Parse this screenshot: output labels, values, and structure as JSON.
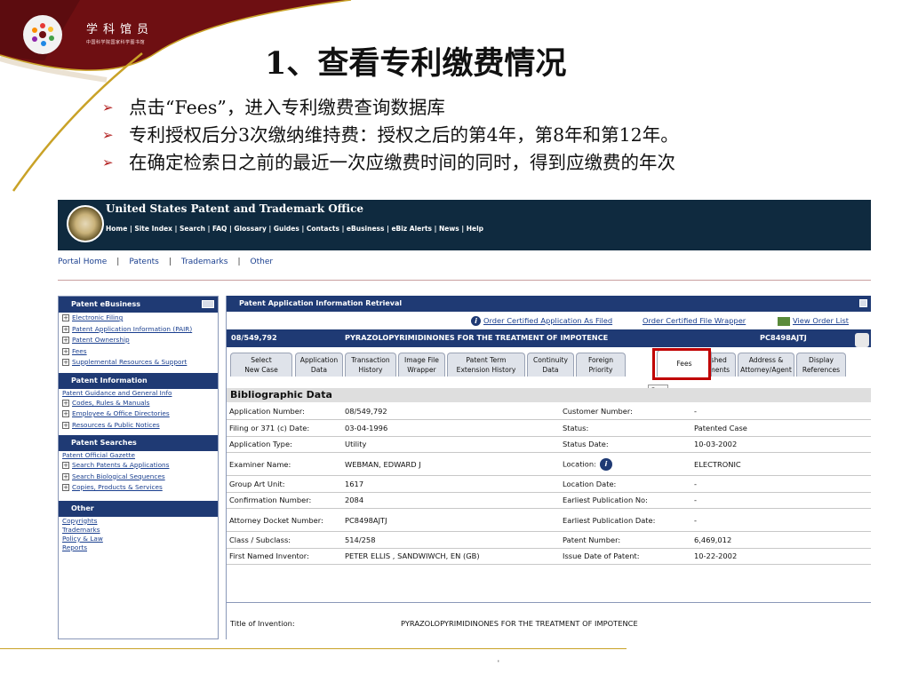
{
  "slide": {
    "logo_title": "学科馆员",
    "logo_subtitle": "中国科学院国家科学图书馆",
    "title": "1、查看专利缴费情况",
    "bullets": [
      "点击“Fees”，进入专利缴费查询数据库",
      "专利授权后分3次缴纳维持费：授权之后的第4年，第8年和第12年。",
      "在确定检索日之前的最近一次应缴费时间的同时，得到应缴费的年次"
    ],
    "page_mark": "'",
    "colors": {
      "banner": "#6e0f12",
      "accent_gold": "#c9a227",
      "arrow": "#b21e1e"
    }
  },
  "uspto": {
    "name": "United States Patent and Trademark Office",
    "nav": [
      "Home",
      "Site Index",
      "Search",
      "FAQ",
      "Glossary",
      "Guides",
      "Contacts",
      "eBusiness",
      "eBiz Alerts",
      "News",
      "Help"
    ],
    "portal_nav": [
      "Portal Home",
      "Patents",
      "Trademarks",
      "Other"
    ]
  },
  "sidebar": {
    "sections": [
      {
        "title": "Patent eBusiness",
        "items": [
          {
            "label": "Electronic Filing",
            "expand": true
          },
          {
            "label": "Patent Application Information (PAIR)",
            "expand": true
          },
          {
            "label": "Patent Ownership",
            "expand": true
          },
          {
            "label": "Fees",
            "expand": true
          },
          {
            "label": "Supplemental Resources & Support",
            "expand": true
          }
        ]
      },
      {
        "title": "Patent Information",
        "items": [
          {
            "label": "Patent Guidance and General Info",
            "expand": false
          },
          {
            "label": "Codes, Rules & Manuals",
            "expand": true
          },
          {
            "label": "Employee & Office Directories",
            "expand": true
          },
          {
            "label": "Resources & Public Notices",
            "expand": true
          }
        ]
      },
      {
        "title": "Patent Searches",
        "items": [
          {
            "label": "Patent Official Gazette",
            "expand": false
          },
          {
            "label": "Search Patents & Applications",
            "expand": true
          },
          {
            "label": "Search Biological Sequences",
            "expand": true
          },
          {
            "label": "Copies, Products & Services",
            "expand": true
          }
        ]
      },
      {
        "title": "Other",
        "items": [
          {
            "label": "Copyrights",
            "expand": false
          },
          {
            "label": "Trademarks",
            "expand": false
          },
          {
            "label": "Policy & Law",
            "expand": false
          },
          {
            "label": "Reports",
            "expand": false
          }
        ]
      }
    ]
  },
  "panel": {
    "title": "Patent Application Information Retrieval",
    "order_links": [
      "Order Certified Application As Filed",
      "Order Certified File Wrapper",
      "View Order List"
    ],
    "app_number": "08/549,792",
    "app_title": "PYRAZOLOPYRIMIDINONES FOR THE TREATMENT OF IMPOTENCE",
    "docket": "PC8498AJTJ",
    "tabs": [
      [
        "Select",
        "New Case"
      ],
      [
        "Application",
        "Data"
      ],
      [
        "Transaction",
        "History"
      ],
      [
        "Image File",
        "Wrapper"
      ],
      [
        "Patent Term",
        "Extension History"
      ],
      [
        "Continuity",
        "Data"
      ],
      [
        "Foreign",
        "Priority"
      ],
      [
        "Fees"
      ],
      [
        "Published",
        "Documents"
      ],
      [
        "Address &",
        "Attorney/Agent"
      ],
      [
        "Display",
        "References"
      ]
    ],
    "tooltip": "Fees",
    "biblio_title": "Bibliographic Data",
    "rows": [
      [
        "Application Number:",
        "08/549,792",
        "Customer Number:",
        "-"
      ],
      [
        "Filing or 371 (c) Date:",
        "03-04-1996",
        "Status:",
        "Patented Case"
      ],
      [
        "Application Type:",
        "Utility",
        "Status Date:",
        "10-03-2002"
      ],
      [
        "Examiner Name:",
        "WEBMAN, EDWARD J",
        "Location:",
        "ELECTRONIC"
      ],
      [
        "Group Art Unit:",
        "1617",
        "Location Date:",
        "-"
      ],
      [
        "Confirmation Number:",
        "2084",
        "Earliest Publication No:",
        "-"
      ],
      [
        "Attorney Docket Number:",
        "PC8498AJTJ",
        "Earliest Publication Date:",
        "-"
      ],
      [
        "Class / Subclass:",
        "514/258",
        "Patent Number:",
        "6,469,012"
      ],
      [
        "First Named Inventor:",
        "PETER ELLIS , SANDWIWCH, EN (GB)",
        "Issue Date of Patent:",
        "10-22-2002"
      ]
    ],
    "title_of_invention_label": "Title of Invention:",
    "title_of_invention": "PYRAZOLOPYRIMIDINONES FOR THE TREATMENT OF IMPOTENCE"
  }
}
